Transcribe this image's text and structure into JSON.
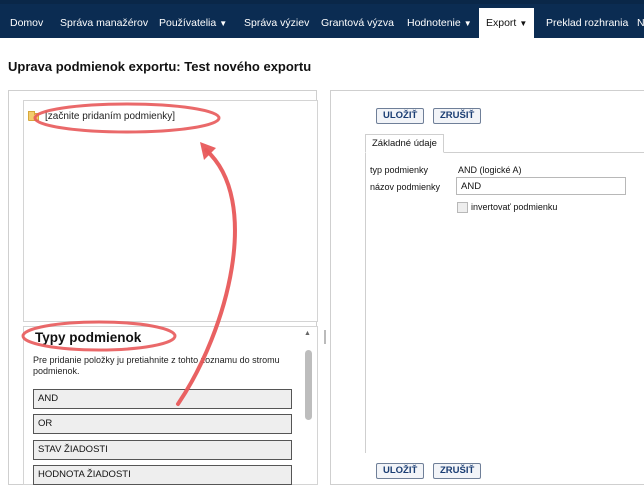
{
  "nav": {
    "items": [
      {
        "label": "Domov",
        "caret": false
      },
      {
        "label": "Správa manažérov",
        "caret": false
      },
      {
        "label": "Používatelia",
        "caret": true
      },
      {
        "label": "Správa výziev",
        "caret": false
      },
      {
        "label": "Grantová výzva",
        "caret": false
      },
      {
        "label": "Hodnotenie",
        "caret": true
      },
      {
        "label": "Export",
        "caret": true,
        "active": true
      },
      {
        "label": "Preklad rozhrania",
        "caret": false
      },
      {
        "label": "N",
        "caret": false
      }
    ]
  },
  "page": {
    "title": "Uprava podmienok exportu: Test nového exportu"
  },
  "tree": {
    "root_label": "[začnite pridaním podmienky]"
  },
  "types": {
    "title": "Typy podmienok",
    "description": "Pre pridanie položky ju pretiahnite z tohto zoznamu do stromu podmienok.",
    "items": [
      "AND",
      "OR",
      "STAV ŽIADOSTI",
      "HODNOTA ŽIADOSTI"
    ]
  },
  "form": {
    "save_label": "ULOŽIŤ",
    "cancel_label": "ZRUŠIŤ",
    "tab_label": "Základné údaje",
    "type_label": "typ podmienky",
    "type_value": "AND (logické A)",
    "name_label": "názov podmienky",
    "name_value": "AND",
    "invert_label": "invertovať podmienku"
  },
  "colors": {
    "nav_bg": "#0b2c52",
    "annotation": "#e8595a",
    "button_text": "#1a3d73"
  },
  "icons": [
    "folder-icon",
    "chevron-down-icon",
    "scroll-up-icon"
  ]
}
